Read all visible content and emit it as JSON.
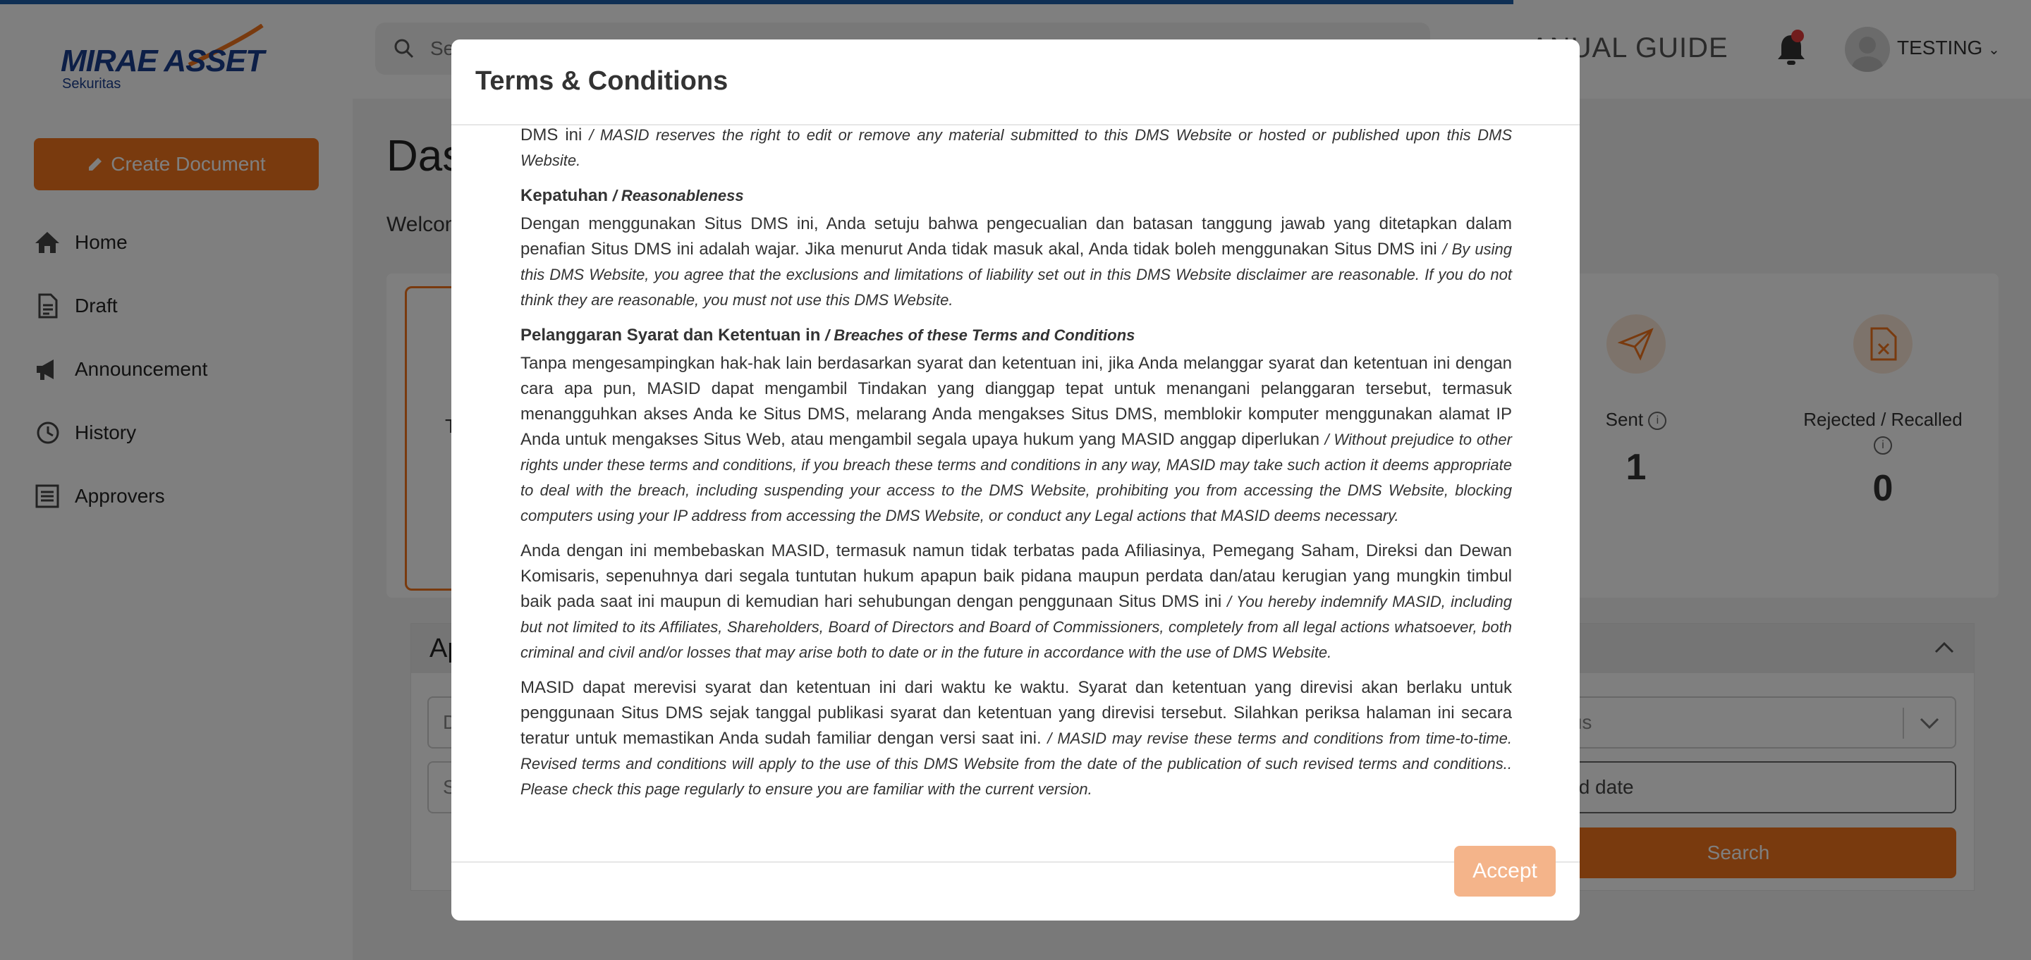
{
  "header": {
    "logo_main": "MIRAE ASSET",
    "logo_sub": "Sekuritas",
    "search_placeholder": "Se",
    "manual_guide": "ANUAL GUIDE",
    "user_name": "TESTING"
  },
  "sidebar": {
    "create_button": "Create Document",
    "items": [
      {
        "label": "Home",
        "icon": "home-icon"
      },
      {
        "label": "Draft",
        "icon": "document-icon"
      },
      {
        "label": "Announcement",
        "icon": "megaphone-icon"
      },
      {
        "label": "History",
        "icon": "history-icon"
      },
      {
        "label": "Approvers",
        "icon": "list-icon"
      }
    ]
  },
  "main": {
    "title": "Das",
    "welcome": "Welcom",
    "active_card_label": "T",
    "stats": [
      {
        "label": "Sent",
        "value": "1",
        "icon": "send-icon"
      },
      {
        "label": "Rejected / Recalled",
        "value": "0",
        "icon": "file-x-icon"
      }
    ],
    "approval_title": "Ap",
    "fields": {
      "left_top": "D",
      "left_bottom": "S",
      "status": "Status",
      "end_date": "ct end date"
    },
    "search_button": "Search"
  },
  "modal": {
    "title": "Terms & Conditions",
    "top_fragment_id": "DMS ini",
    "top_fragment_en": "/ MASID reserves the right to edit or remove any material submitted to this DMS Website or hosted or published upon this DMS Website.",
    "sections": [
      {
        "heading_id": "Kepatuhan",
        "heading_en": "/ Reasonableness",
        "paragraphs": [
          {
            "id": "Dengan menggunakan Situs DMS ini, Anda setuju bahwa pengecualian dan batasan tanggung jawab yang ditetapkan dalam penafian Situs DMS ini adalah wajar. Jika menurut Anda tidak masuk akal, Anda tidak boleh menggunakan Situs DMS ini",
            "en": "/ By using this DMS Website, you agree that the exclusions and limitations of liability set out in this DMS Website disclaimer are reasonable. If you do not think they are reasonable, you must not use this DMS Website."
          }
        ]
      },
      {
        "heading_id": "Pelanggaran Syarat dan Ketentuan in",
        "heading_en": "/ Breaches of these Terms and Conditions",
        "paragraphs": [
          {
            "id": "Tanpa mengesampingkan hak-hak lain berdasarkan syarat dan ketentuan ini, jika Anda melanggar syarat dan ketentuan ini dengan cara apa pun, MASID dapat mengambil Tindakan yang dianggap tepat untuk menangani pelanggaran tersebut, termasuk menangguhkan akses Anda ke Situs DMS, melarang Anda mengakses Situs DMS, memblokir komputer menggunakan alamat IP Anda untuk mengakses Situs Web, atau mengambil segala upaya hukum yang MASID anggap diperlukan",
            "en": "/ Without prejudice to other rights under these terms and conditions, if you breach these terms and conditions in any way, MASID may take such action it deems appropriate to deal with the breach, including suspending your access to the DMS Website, prohibiting you from accessing the DMS Website, blocking computers using your IP address from accessing the DMS Website, or conduct any Legal actions that MASID deems necessary."
          },
          {
            "id": "Anda dengan ini membebaskan MASID, termasuk namun tidak terbatas pada Afiliasinya, Pemegang Saham, Direksi dan Dewan Komisaris, sepenuhnya dari segala tuntutan hukum apapun baik pidana maupun perdata dan/atau kerugian yang mungkin timbul baik pada saat ini maupun di kemudian hari sehubungan dengan penggunaan Situs DMS ini",
            "en": "/ You hereby indemnify MASID, including but not limited to its Affiliates, Shareholders, Board of Directors and Board of Commissioners, completely from all legal actions whatsoever, both criminal and civil and/or losses that may arise both to date or in the future in accordance with the use of DMS Website."
          },
          {
            "id": "MASID dapat merevisi syarat dan ketentuan ini dari waktu ke waktu. Syarat dan ketentuan yang direvisi akan berlaku untuk penggunaan Situs DMS sejak tanggal publikasi syarat dan ketentuan yang direvisi tersebut. Silahkan periksa halaman ini secara teratur untuk memastikan Anda sudah familiar dengan versi saat ini.",
            "en": "/ MASID may revise these terms and conditions from time-to-time. Revised terms and conditions will apply to the use of this DMS Website from the date of the publication of such revised terms and conditions.. Please check this page regularly to ensure you are familiar with the current version."
          }
        ]
      }
    ],
    "accept_button": "Accept"
  },
  "colors": {
    "brand_orange": "#f2741d",
    "brand_blue": "#1a3f8f",
    "accept_disabled": "#f4b48a"
  }
}
